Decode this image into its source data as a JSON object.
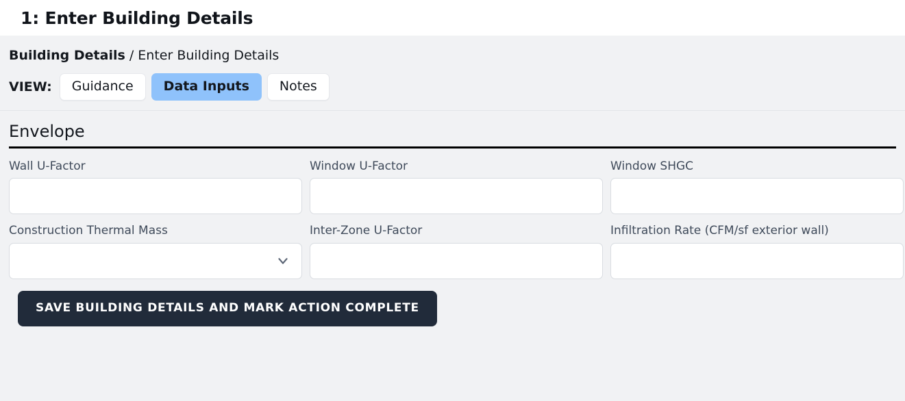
{
  "header": {
    "title": "1: Enter Building Details"
  },
  "breadcrumb": {
    "parent": "Building Details",
    "separator": " / ",
    "current": "Enter Building Details"
  },
  "view_switcher": {
    "label": "VIEW:",
    "tabs": [
      {
        "label": "Guidance",
        "active": false
      },
      {
        "label": "Data Inputs",
        "active": true
      },
      {
        "label": "Notes",
        "active": false
      }
    ],
    "active_color": "#8fc2fb"
  },
  "section": {
    "title": "Envelope",
    "fields": [
      {
        "label": "Wall U-Factor",
        "type": "text",
        "value": "",
        "placeholder": ""
      },
      {
        "label": "Window U-Factor",
        "type": "text",
        "value": "",
        "placeholder": ""
      },
      {
        "label": "Window SHGC",
        "type": "text",
        "value": "",
        "placeholder": ""
      },
      {
        "label": "Construction Thermal Mass",
        "type": "select",
        "value": "",
        "placeholder": "",
        "icon": "chevron-down-icon"
      },
      {
        "label": "Inter-Zone U-Factor",
        "type": "text",
        "value": "",
        "placeholder": ""
      },
      {
        "label": "Infiltration Rate (CFM/sf exterior wall)",
        "type": "text",
        "value": "",
        "placeholder": ""
      }
    ]
  },
  "actions": {
    "save_label": "SAVE BUILDING DETAILS AND MARK ACTION COMPLETE",
    "save_color": "#212b3a"
  }
}
